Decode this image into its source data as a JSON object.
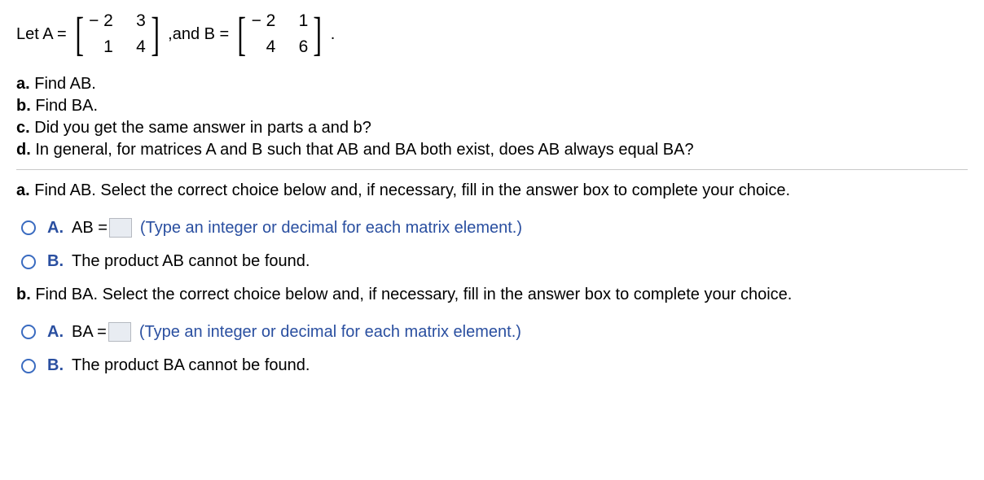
{
  "problem": {
    "let_text_1": "Let A =",
    "matrixA": [
      "− 2",
      "3",
      "1",
      "4"
    ],
    "sep1": ",",
    "and_text": " and B =",
    "matrixB": [
      "− 2",
      "1",
      "4",
      "6"
    ],
    "sep2": "."
  },
  "questions": {
    "a": {
      "label": "a.",
      "text": " Find AB."
    },
    "b": {
      "label": "b.",
      "text": " Find BA."
    },
    "c": {
      "label": "c.",
      "text": " Did you get the same answer in parts a and b?"
    },
    "d": {
      "label": "d.",
      "text": " In general, for matrices A and B such that AB and BA both exist, does AB always equal BA?"
    }
  },
  "partA": {
    "prompt_label": "a.",
    "prompt_text": " Find AB. Select the correct choice below and, if necessary, fill in the answer box to complete your choice.",
    "optA_label": "A.",
    "optA_prefix": "AB =",
    "optA_hint": "(Type an integer or decimal for each matrix element.)",
    "optB_label": "B.",
    "optB_text": "The product AB cannot be found."
  },
  "partB": {
    "prompt_label": "b.",
    "prompt_text": " Find BA. Select the correct choice below and, if necessary, fill in the answer box to complete your choice.",
    "optA_label": "A.",
    "optA_prefix": "BA =",
    "optA_hint": "(Type an integer or decimal for each matrix element.)",
    "optB_label": "B.",
    "optB_text": "The product BA cannot be found."
  }
}
